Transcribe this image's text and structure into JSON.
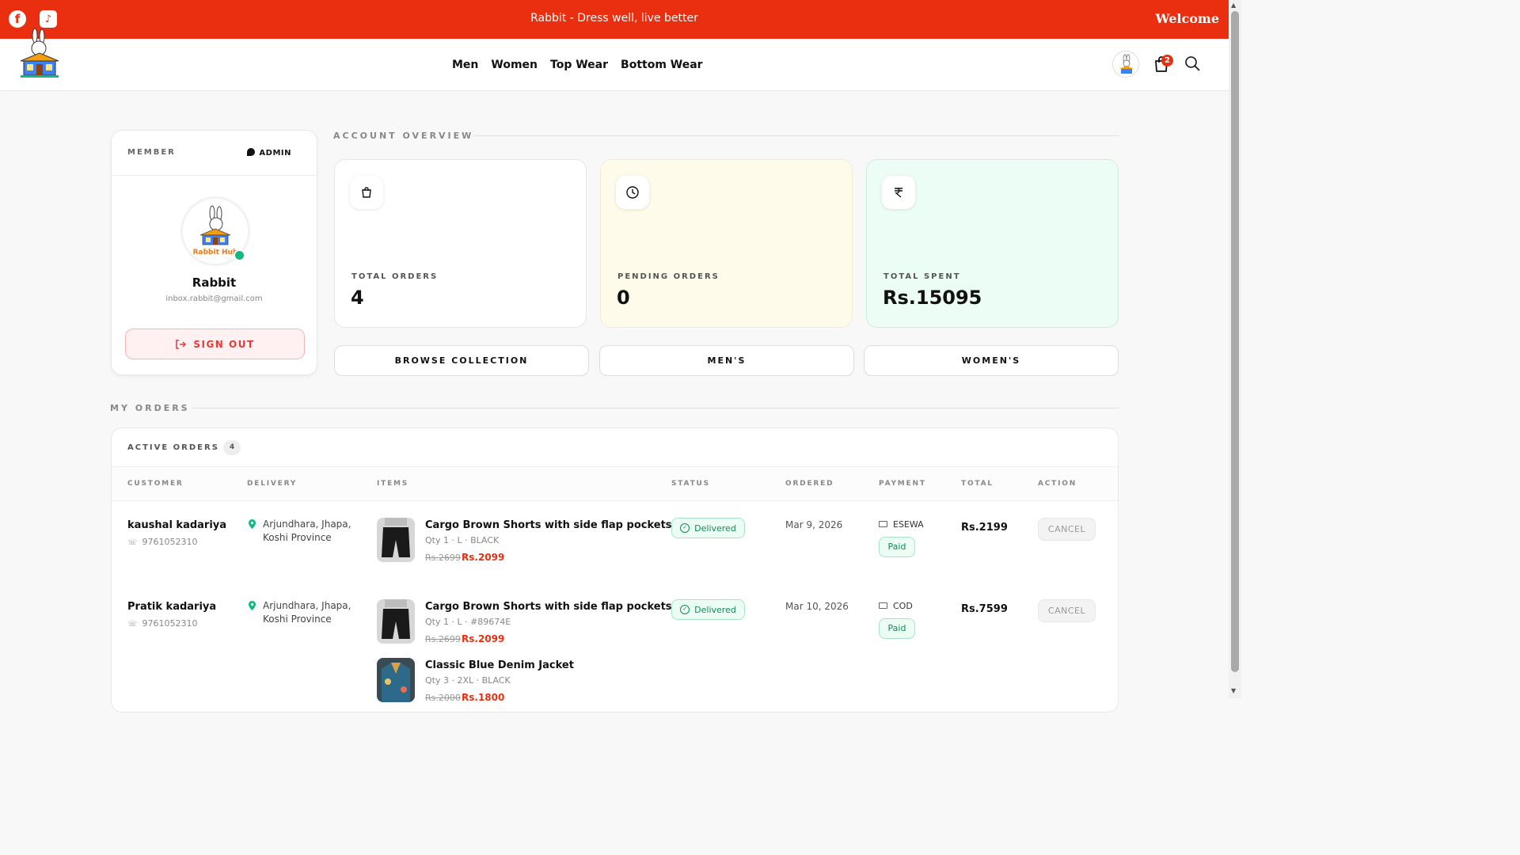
{
  "topbar": {
    "tagline": "Rabbit - Dress well, live better",
    "welcome": "Welcome",
    "social_icons": [
      "facebook-icon",
      "tiktok-icon"
    ]
  },
  "nav": {
    "links": [
      "Men",
      "Women",
      "Top Wear",
      "Bottom Wear"
    ],
    "cart_count": "2"
  },
  "member": {
    "label": "MEMBER",
    "role": "ADMIN",
    "avatar_text": "Rabbit Hub",
    "name": "Rabbit",
    "email": "inbox.rabbit@gmail.com",
    "signout": "SIGN OUT"
  },
  "overview": {
    "title": "ACCOUNT OVERVIEW",
    "stats": [
      {
        "label": "TOTAL ORDERS",
        "value": "4",
        "icon": "shopping-bag-icon"
      },
      {
        "label": "PENDING ORDERS",
        "value": "0",
        "icon": "clock-icon"
      },
      {
        "label": "TOTAL SPENT",
        "value": "Rs.15095",
        "icon": "rupee-icon"
      }
    ],
    "buttons": [
      "BROWSE COLLECTION",
      "MEN'S",
      "WOMEN'S"
    ]
  },
  "orders": {
    "title": "MY ORDERS",
    "active_label": "ACTIVE ORDERS",
    "active_count": "4",
    "columns": [
      "CUSTOMER",
      "DELIVERY",
      "ITEMS",
      "STATUS",
      "ORDERED",
      "PAYMENT",
      "TOTAL",
      "ACTION"
    ],
    "rows": [
      {
        "customer": "kaushal kadariya",
        "phone": "9761052310",
        "address_line1": "Arjundhara, Jhapa,",
        "address_line2": "Koshi Province",
        "items": [
          {
            "name": "Cargo Brown Shorts with side flap pockets",
            "meta": "Qty 1 · L · BLACK",
            "old_price": "Rs.2699",
            "price": "Rs.2099"
          }
        ],
        "status": "Delivered",
        "ordered": "Mar 9, 2026",
        "payment_method": "ESEWA",
        "payment_status": "Paid",
        "total": "Rs.2199",
        "action": "CANCEL"
      },
      {
        "customer": "Pratik kadariya",
        "phone": "9761052310",
        "address_line1": "Arjundhara, Jhapa,",
        "address_line2": "Koshi Province",
        "items": [
          {
            "name": "Cargo Brown Shorts with side flap pockets",
            "meta": "Qty 1 · L · #89674E",
            "old_price": "Rs.2699",
            "price": "Rs.2099"
          },
          {
            "name": "Classic Blue Denim Jacket",
            "meta": "Qty 3 · 2XL · BLACK",
            "old_price": "Rs.2000",
            "price": "Rs.1800"
          }
        ],
        "status": "Delivered",
        "ordered": "Mar 10, 2026",
        "payment_method": "COD",
        "payment_status": "Paid",
        "total": "Rs.7599",
        "action": "CANCEL"
      }
    ]
  },
  "colors": {
    "brand_red": "#ea2e10",
    "success_green": "#138a55",
    "pending_bg": "#fffbeb",
    "spent_bg": "#ecfdf5"
  }
}
